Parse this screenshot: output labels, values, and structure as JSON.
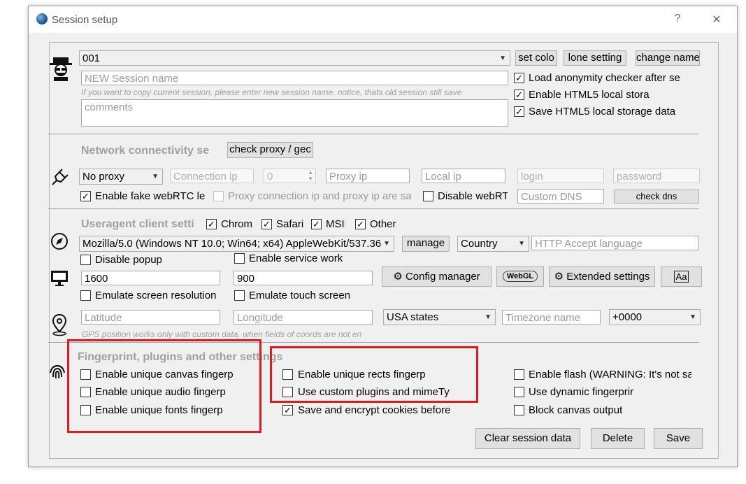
{
  "window": {
    "title": "Session setup",
    "help_icon": "?",
    "close_icon": "✕"
  },
  "session": {
    "selected": "001",
    "buttons": {
      "set_color": "set colo",
      "clone": "lone setting",
      "change_name": "change name"
    },
    "name_placeholder": "NEW Session name",
    "hint": "If you want to copy current session, please enter new session name. notice, thats old session still save",
    "comments_placeholder": "comments",
    "options": [
      {
        "label": "Load anonymity checker after se",
        "checked": true
      },
      {
        "label": "Enable HTML5 local stora",
        "checked": true
      },
      {
        "label": "Save HTML5 local storage data",
        "checked": true
      }
    ]
  },
  "network": {
    "title": "Network connectivity se",
    "check_proxy": "check proxy / gec",
    "proxy_type": "No proxy",
    "connection_ip_placeholder": "Connection ip",
    "port_value": "0",
    "proxy_ip_placeholder": "Proxy ip",
    "local_ip_placeholder": "Local ip",
    "login_placeholder": "login",
    "password_placeholder": "password",
    "fake_webrtc": {
      "label": "Enable fake webRTC le",
      "checked": true
    },
    "same_ip": {
      "label": "Proxy connection ip and proxy ip are sa",
      "checked": false
    },
    "disable_webrtc": {
      "label": "Disable webRT",
      "checked": false
    },
    "custom_dns_placeholder": "Custom DNS",
    "check_dns": "check dns"
  },
  "useragent": {
    "title": "Useragent client setti",
    "browsers": [
      {
        "label": "Chrom",
        "checked": true
      },
      {
        "label": "Safari",
        "checked": true
      },
      {
        "label": "MSIE",
        "checked": true
      },
      {
        "label": "Other",
        "checked": true
      }
    ],
    "ua_value": "Mozilla/5.0 (Windows NT 10.0; Win64; x64) AppleWebKit/537.36",
    "manage": "manage",
    "country": "Country",
    "accept_lang_placeholder": "HTTP Accept language",
    "disable_popup": {
      "label": "Disable popup",
      "checked": false
    },
    "service_work": {
      "label": "Enable service work",
      "checked": false
    },
    "width": "1600",
    "height": "900",
    "config_manager": "Config manager",
    "webgl": "WebGL",
    "extended_settings": "Extended settings",
    "font_btn": "Aa",
    "emulate_resolution": {
      "label": "Emulate screen resolution",
      "checked": false
    },
    "emulate_touch": {
      "label": "Emulate touch screen",
      "checked": false
    }
  },
  "geo": {
    "latitude_placeholder": "Latitude",
    "longitude_placeholder": "Longitude",
    "states": "USA states",
    "timezone_placeholder": "Timezone name",
    "offset": "+0000",
    "hint": "GPS position works only with custom data, when fields of coords are not en"
  },
  "fingerprint": {
    "title": "Fingerprint, plugins and other settings",
    "col1": [
      {
        "label": "Enable unique canvas fingerp",
        "checked": false
      },
      {
        "label": "Enable unique audio fingerp",
        "checked": false
      },
      {
        "label": "Enable unique fonts fingerp",
        "checked": false
      }
    ],
    "col2": [
      {
        "label": "Enable unique rects fingerp",
        "checked": false
      },
      {
        "label": "Use custom plugins and mimeTy",
        "checked": false
      },
      {
        "label": "Save and encrypt cookies before",
        "checked": true
      }
    ],
    "col3": [
      {
        "label": "Enable flash (WARNING: It's not sa",
        "checked": false
      },
      {
        "label": "Use dynamic fingerprir",
        "checked": false
      },
      {
        "label": "Block canvas output",
        "checked": false
      }
    ]
  },
  "footer": {
    "clear": "Clear session data",
    "delete": "Delete",
    "save": "Save"
  },
  "colors": {
    "highlight": "#e11b1b",
    "section_title": "#a0a0a0",
    "window_bg": "#f0f0f0"
  }
}
